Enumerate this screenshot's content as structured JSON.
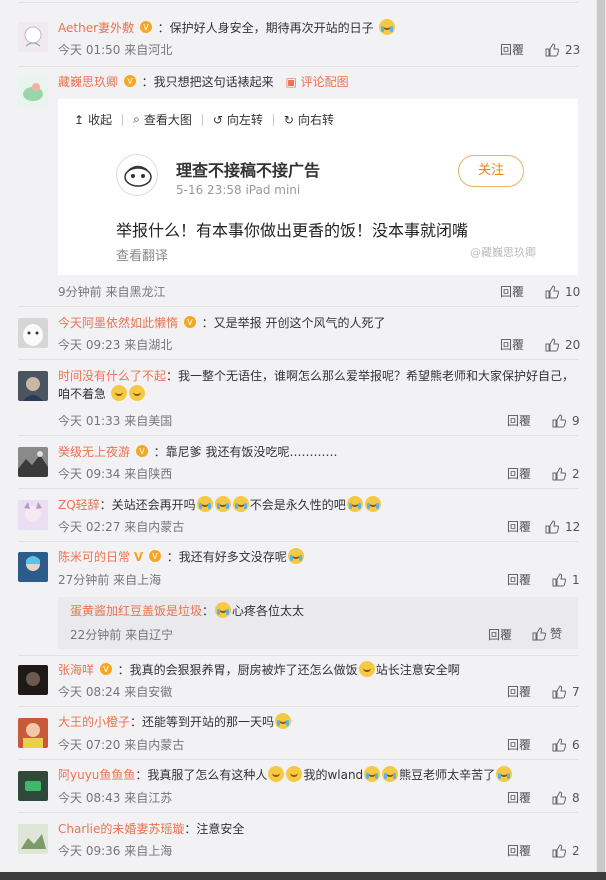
{
  "common": {
    "reply_label": "回覆"
  },
  "comments": [
    {
      "user": "Aether妻外敷",
      "text": "：保护好人身安全，期待再次开站的日子",
      "time": "今天 01:50 来自河北",
      "likes": "23"
    },
    {
      "user": "藏巍思玖卿",
      "text": "：我只想把这句话裱起来",
      "link": "评论配图",
      "time": "9分钟前 来自黑龙江",
      "likes": "10"
    },
    {
      "user": "今天阿墨依然如此懒惰",
      "text": "：又是举报 开创这个风气的人死了",
      "time": "今天 09:23 来自湖北",
      "likes": "20"
    },
    {
      "user": "时间没有什么了不起",
      "text": "：我一整个无语住，谁啊怎么那么爱举报呢？希望熊老师和大家保护好自己，",
      "text2": "咱不着急",
      "time": "今天 01:33 来自美国",
      "likes": "9"
    },
    {
      "user": "癸级无上夜游",
      "text": "：靠尼爹 我还有饭没吃呢…………",
      "time": "今天 09:34 来自陕西",
      "likes": "2"
    },
    {
      "user": "ZQ轻辞",
      "text": "：关站还会再开吗",
      "text_b": "不会是永久性的吧",
      "time": "今天 02:27 来自内蒙古",
      "likes": "12"
    },
    {
      "user": "陈米可的日常",
      "text": "：我还有好多文没存呢",
      "time": "27分钟前 来自上海",
      "likes": "1"
    },
    {
      "user": "张海咩",
      "text": "：我真的会狠狠养胃，厨房被炸了还怎么做饭",
      "text_b": "站长注意安全啊",
      "time": "今天 08:24 来自安徽",
      "likes": "7"
    },
    {
      "user": "大王的小橙子",
      "text": "：还能等到开站的那一天吗",
      "time": "今天 07:20 来自内蒙古",
      "likes": "6"
    },
    {
      "user": "阿yuyu鱼鱼鱼",
      "text": "：我真服了怎么有这种人",
      "text_b": "我的wland",
      "text_c": "熊豆老师太辛苦了",
      "time": "今天 08:43 来自江苏",
      "likes": "8"
    },
    {
      "user": "Charlie的未婚妻苏瑶璇",
      "text": "：注意安全",
      "time": "今天 09:36 来自上海",
      "likes": "2"
    }
  ],
  "subreply": {
    "user": "蛋黄酱加红豆盖饭是垃圾",
    "text": "：",
    "text_b": "心疼各位太太",
    "time": "22分钟前 来自辽宁",
    "like_label": "赞"
  },
  "card": {
    "toolbar": [
      "收起",
      "查看大图",
      "向左转",
      "向右转"
    ],
    "name": "理查不接稿不接广告",
    "meta": "5-16 23:58   iPad mini",
    "follow": "关注",
    "text": "举报什么！有本事你做出更香的饭！没本事就闭嘴",
    "translate": "查看翻译",
    "watermark": "@藏巍思玖卿"
  },
  "colors": {
    "username": "#eb7350",
    "follow": "#e8870f",
    "vip": "#f5a623"
  }
}
